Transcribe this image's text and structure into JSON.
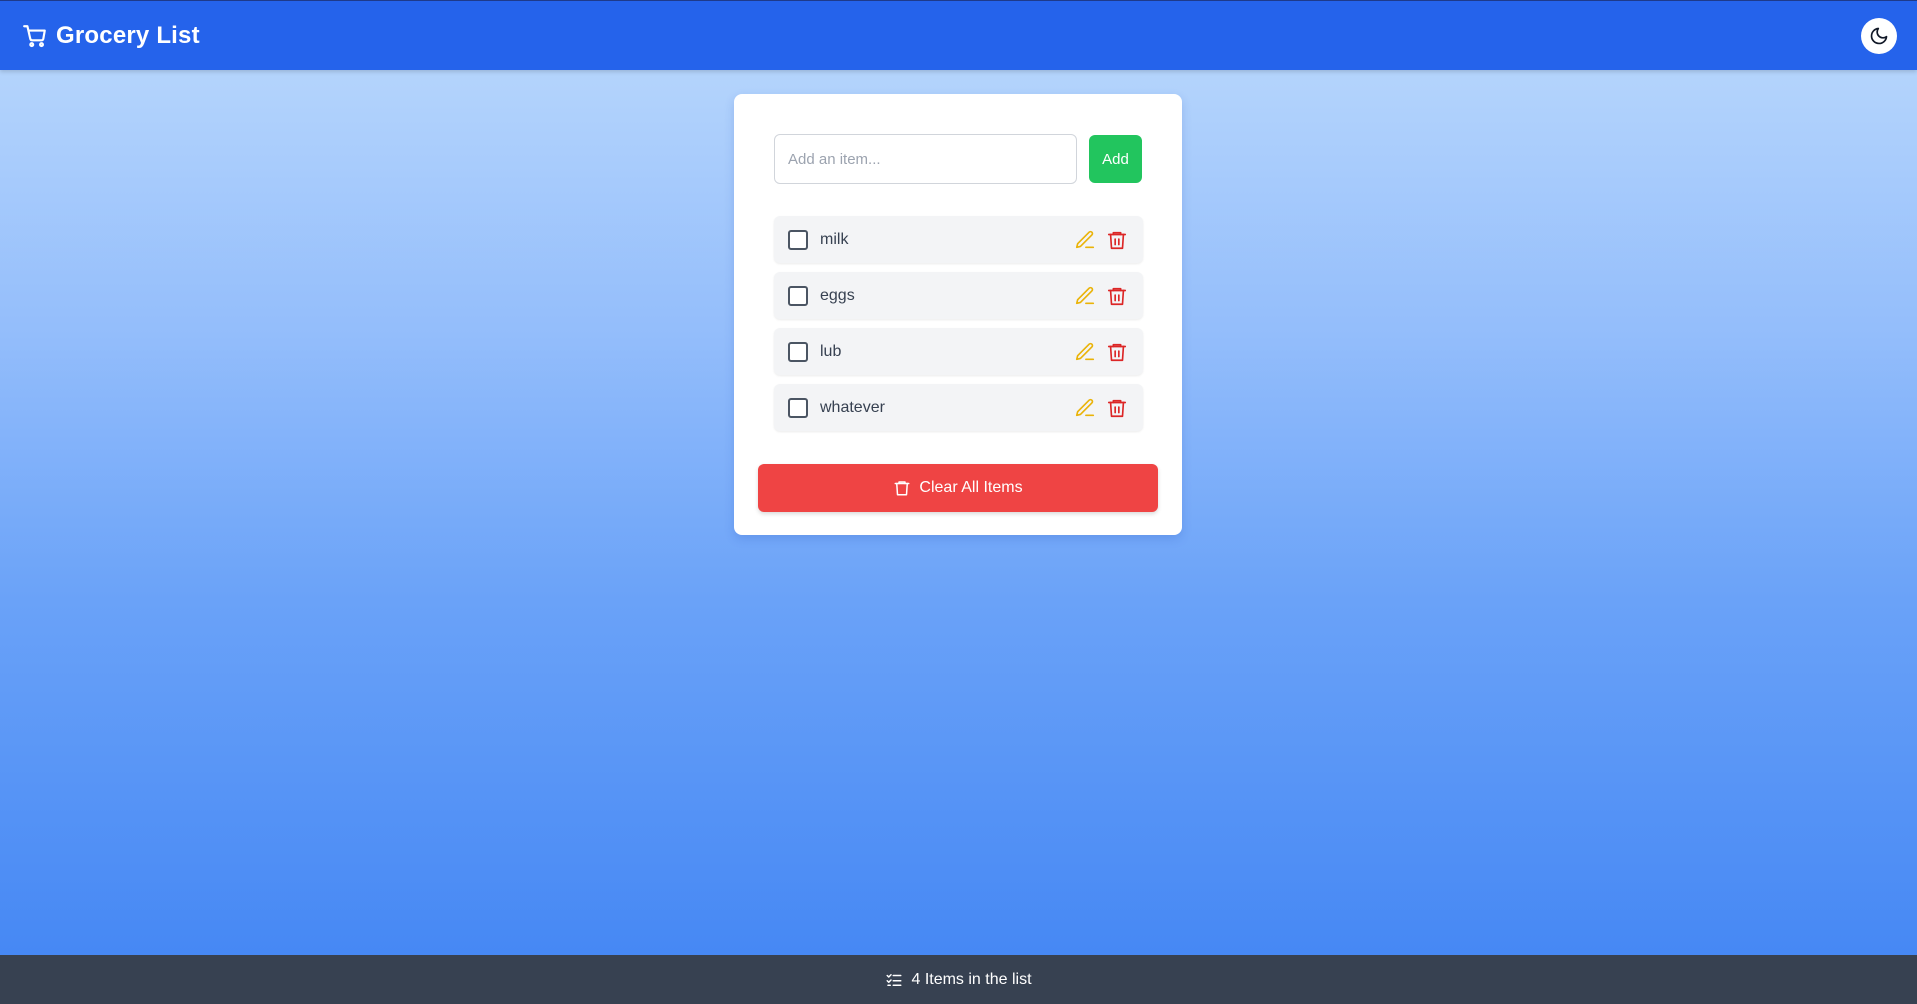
{
  "header": {
    "title": "Grocery List",
    "cart_icon": "shopping-cart-icon",
    "theme_toggle_icon": "moon-icon"
  },
  "add_form": {
    "placeholder": "Add an item...",
    "value": "",
    "add_label": "Add"
  },
  "items": [
    {
      "label": "milk",
      "checked": false
    },
    {
      "label": "eggs",
      "checked": false
    },
    {
      "label": "lub",
      "checked": false
    },
    {
      "label": "whatever",
      "checked": false
    }
  ],
  "clear_button": {
    "label": "Clear All Items",
    "icon": "trash-icon"
  },
  "footer": {
    "count_text": "4 Items in the list",
    "icon": "list-check-icon"
  },
  "colors": {
    "header_bg": "#2563eb",
    "add_button": "#22c55e",
    "clear_button": "#ef4444",
    "edit_icon": "#eab308",
    "delete_icon": "#dc2626",
    "footer_bg": "#374151"
  }
}
